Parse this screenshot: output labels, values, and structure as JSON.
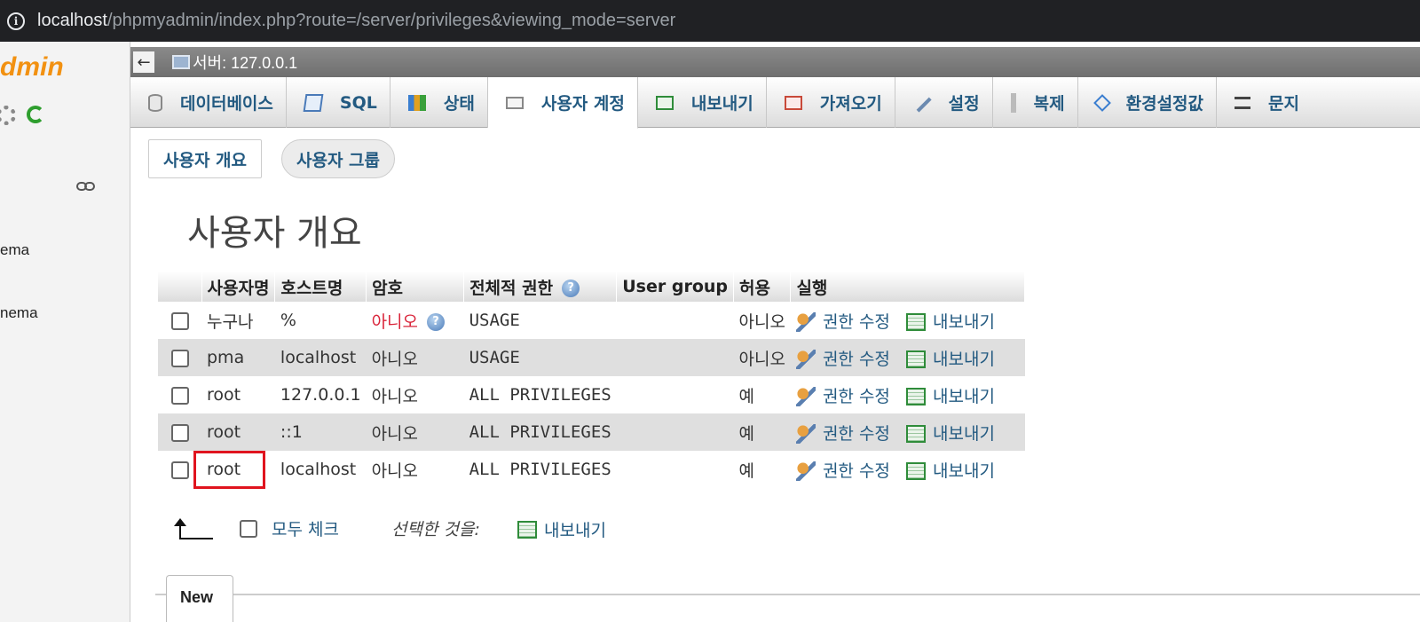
{
  "browser": {
    "url_host": "localhost",
    "url_path": "/phpmyadmin/index.php?route=/server/privileges&viewing_mode=server"
  },
  "sidebar": {
    "logo": "dmin",
    "items": [
      "ema",
      "nema"
    ]
  },
  "breadcrumb": {
    "back": "←",
    "server": "서버: 127.0.0.1"
  },
  "tabs": [
    {
      "label": "데이터베이스",
      "icon": "database-icon"
    },
    {
      "label": "SQL",
      "icon": "sql-icon"
    },
    {
      "label": "상태",
      "icon": "status-icon"
    },
    {
      "label": "사용자 계정",
      "icon": "users-icon",
      "active": true
    },
    {
      "label": "내보내기",
      "icon": "export-icon"
    },
    {
      "label": "가져오기",
      "icon": "import-icon"
    },
    {
      "label": "설정",
      "icon": "wrench-icon"
    },
    {
      "label": "복제",
      "icon": "replication-icon"
    },
    {
      "label": "환경설정값",
      "icon": "variables-icon"
    },
    {
      "label": "문지",
      "icon": "charsets-icon"
    }
  ],
  "subtabs": {
    "overview": "사용자 개요",
    "groups": "사용자 그룹"
  },
  "page_title": "사용자 개요",
  "table": {
    "headers": {
      "username": "사용자명",
      "host": "호스트명",
      "password": "암호",
      "global_privileges": "전체적 권한",
      "user_group": "User group",
      "grant": "허용",
      "action": "실행"
    },
    "rows": [
      {
        "user": "누구나",
        "host": "%",
        "password": "아니오",
        "privileges": "USAGE",
        "grant": "아니오",
        "any": true
      },
      {
        "user": "pma",
        "host": "localhost",
        "password": "아니오",
        "privileges": "USAGE",
        "grant": "아니오"
      },
      {
        "user": "root",
        "host": "127.0.0.1",
        "password": "아니오",
        "privileges": "ALL PRIVILEGES",
        "grant": "예"
      },
      {
        "user": "root",
        "host": "::1",
        "password": "아니오",
        "privileges": "ALL PRIVILEGES",
        "grant": "예"
      },
      {
        "user": "root",
        "host": "localhost",
        "password": "아니오",
        "privileges": "ALL PRIVILEGES",
        "grant": "예"
      }
    ],
    "edit_label": "권한 수정",
    "export_label": "내보내기"
  },
  "footer": {
    "check_all": "모두 체크",
    "with_selected": "선택한 것을:",
    "export": "내보내기"
  },
  "new_tab": "New",
  "colors": {
    "link": "#235a81",
    "no": "#d9243a",
    "highlight": "#e0141e",
    "logo": "#f29111"
  }
}
